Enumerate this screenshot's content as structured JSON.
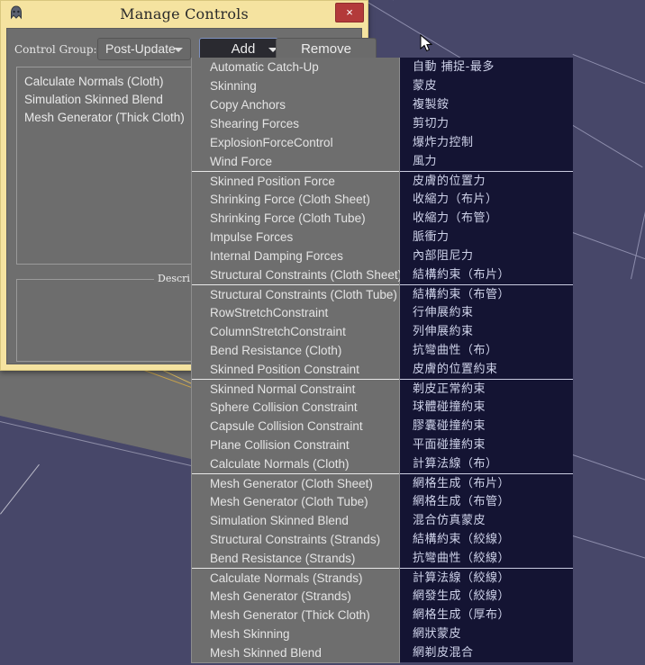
{
  "window": {
    "title": "Manage Controls",
    "app_icon": "app-icon",
    "close_label": "×"
  },
  "toolbar": {
    "control_group_label": "Control Group:",
    "control_group_value": "Post-Update",
    "add_label": "Add",
    "remove_label": "Remove"
  },
  "controls_list": {
    "items": [
      "Calculate Normals (Cloth)",
      "Simulation Skinned Blend",
      "Mesh Generator (Thick Cloth)"
    ]
  },
  "description_group": {
    "title": "Descri"
  },
  "menu_en": {
    "groups": [
      {
        "items": [
          "Automatic Catch-Up",
          "Skinning",
          "Copy Anchors",
          "Shearing Forces",
          "ExplosionForceControl",
          "Wind Force"
        ]
      },
      {
        "items": [
          "Skinned Position Force",
          "Shrinking Force (Cloth Sheet)",
          "Shrinking Force (Cloth Tube)",
          "Impulse Forces",
          "Internal Damping Forces",
          "Structural Constraints (Cloth Sheet)"
        ]
      },
      {
        "items": [
          "Structural Constraints (Cloth Tube)",
          "RowStretchConstraint",
          "ColumnStretchConstraint",
          "Bend Resistance (Cloth)",
          "Skinned Position Constraint"
        ]
      },
      {
        "items": [
          "Skinned Normal Constraint",
          "Sphere Collision Constraint",
          "Capsule Collision Constraint",
          "Plane Collision Constraint",
          "Calculate Normals (Cloth)"
        ]
      },
      {
        "items": [
          "Mesh Generator (Cloth Sheet)",
          "Mesh Generator (Cloth Tube)",
          "Simulation Skinned Blend",
          "Structural Constraints (Strands)",
          "Bend Resistance (Strands)"
        ]
      },
      {
        "items": [
          "Calculate Normals (Strands)",
          "Mesh Generator (Strands)",
          "Mesh Generator (Thick Cloth)",
          "Mesh Skinning",
          "Mesh Skinned Blend"
        ]
      }
    ]
  },
  "menu_zh": {
    "groups": [
      {
        "items": [
          "自動 捕捉-最多",
          "蒙皮",
          "複製銨",
          "剪切力",
          "爆炸力控制",
          "風力"
        ]
      },
      {
        "items": [
          "皮膚的位置力",
          "收縮力（布片）",
          "收縮力（布管）",
          "脈衝力",
          "內部阻尼力",
          "結構約束（布片）"
        ]
      },
      {
        "items": [
          "結構約束（布管）",
          "行伸展約束",
          "列伸展約束",
          "抗彎曲性（布）",
          "皮膚的位置約束"
        ]
      },
      {
        "items": [
          "剃皮正常約束",
          "球體碰撞約束",
          "膠囊碰撞約束",
          "平面碰撞約束",
          "計算法線（布）"
        ]
      },
      {
        "items": [
          "網格生成（布片）",
          "網格生成（布管）",
          "混合仿真蒙皮",
          "結構約束（絞線）",
          "抗彎曲性（絞線）"
        ]
      },
      {
        "items": [
          "計算法線（絞線）",
          "網發生成（絞線）",
          "網格生成（厚布）",
          "網狀蒙皮",
          "網剃皮混合"
        ]
      }
    ]
  },
  "colors": {
    "dialog_frame": "#f5e3a0",
    "menu_en_bg": "#6e6e6e",
    "menu_zh_bg": "#141433",
    "viewport_bg": "#474769",
    "ground": "#6e6e6e",
    "close_button": "#b33a3a",
    "add_border": "#7d90c0"
  }
}
